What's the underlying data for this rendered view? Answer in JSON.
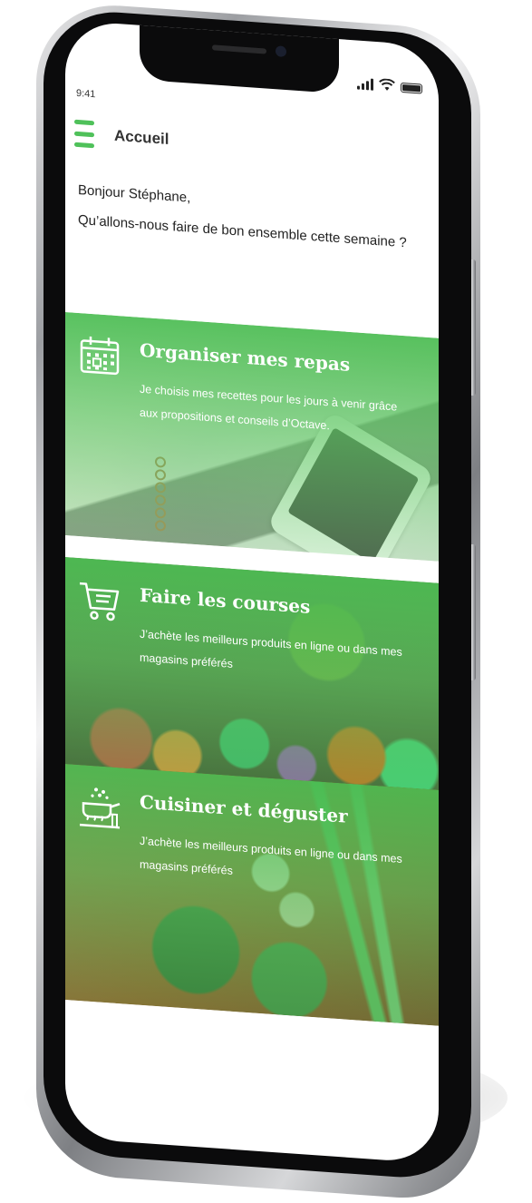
{
  "status_bar": {
    "time": "9:41"
  },
  "header": {
    "title": "Accueil",
    "menu_icon": "hamburger-menu-icon"
  },
  "greeting": {
    "line1": "Bonjour Stéphane,",
    "line2": "Qu’allons-nous faire de bon ensemble cette semaine ?"
  },
  "cards": [
    {
      "icon": "calendar-icon",
      "title": "Organiser mes repas",
      "description": "Je choisis mes recettes pour les jours à venir grâce aux propositions et conseils d’Octave."
    },
    {
      "icon": "shopping-cart-icon",
      "title": "Faire les courses",
      "description": "J’achète les meilleurs produits en ligne ou dans mes magasins préférés"
    },
    {
      "icon": "cooking-pot-icon",
      "title": "Cuisiner et déguster",
      "description": "J’achète les meilleurs produits en ligne ou dans mes magasins préférés"
    }
  ],
  "colors": {
    "accent": "#4fc15a",
    "card_overlay": "#4cbe54",
    "text_dark": "#222222"
  }
}
